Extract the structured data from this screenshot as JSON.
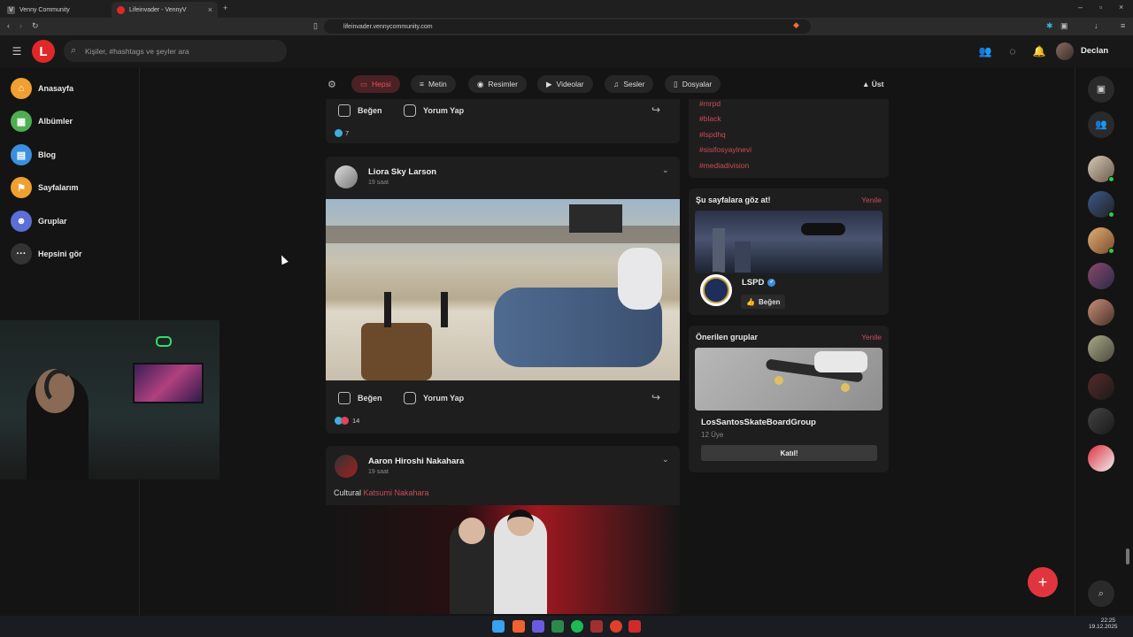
{
  "browser": {
    "tabs": [
      {
        "title": "Venny Community"
      },
      {
        "title": "Lifeinvader - VennyV"
      }
    ],
    "url": "lifeinvader.vennycommunity.com"
  },
  "header": {
    "logo_letter": "L",
    "search_placeholder": "Kişiler, #hashtags ve şeyler ara",
    "user_name": "Declan"
  },
  "sidebar": {
    "items": [
      {
        "label": "Anasayfa",
        "icon": "home-icon",
        "color": "#f0a030"
      },
      {
        "label": "Albümler",
        "icon": "album-icon",
        "color": "#4caf50"
      },
      {
        "label": "Blog",
        "icon": "blog-icon",
        "color": "#3b8fe0"
      },
      {
        "label": "Sayfalarım",
        "icon": "flag-icon",
        "color": "#f0a030"
      },
      {
        "label": "Gruplar",
        "icon": "group-icon",
        "color": "#5b6fd6"
      },
      {
        "label": "Hepsini gör",
        "icon": "more-icon",
        "color": "#333333"
      }
    ]
  },
  "filters": {
    "items": [
      {
        "label": "Hepsi"
      },
      {
        "label": "Metin"
      },
      {
        "label": "Resimler"
      },
      {
        "label": "Videolar"
      },
      {
        "label": "Sesler"
      },
      {
        "label": "Dosyalar"
      }
    ],
    "top_label": "Üst"
  },
  "feed": {
    "like_label": "Beğen",
    "comment_label": "Yorum Yap",
    "post0": {
      "reactions": "7"
    },
    "post1": {
      "author": "Liora Sky Larson",
      "time": "19 saat",
      "reactions": "14"
    },
    "post2": {
      "author": "Aaron Hiroshi Nakahara",
      "time": "19 saat",
      "text": "Cultural",
      "mention": "Katsumi Nakahara"
    }
  },
  "right": {
    "tags": [
      "#mrpd",
      "#black",
      "#lspdhq",
      "#sisifosyayinevi",
      "#mediadivision"
    ],
    "pages": {
      "title": "Şu sayfalara göz at!",
      "refresh": "Yenile",
      "name": "LSPD",
      "like": "Beğen"
    },
    "groups": {
      "title": "Önerilen gruplar",
      "refresh": "Yenile",
      "name": "LosSantosSkateBoardGroup",
      "members": "12 Üye",
      "join": "Katıl!"
    }
  },
  "taskbar": {
    "time": "22:25",
    "date": "19.12.2025"
  },
  "colors": {
    "accent": "#e02828",
    "tag": "#d04a58",
    "background": "#141414",
    "card": "#1e1e1e"
  }
}
